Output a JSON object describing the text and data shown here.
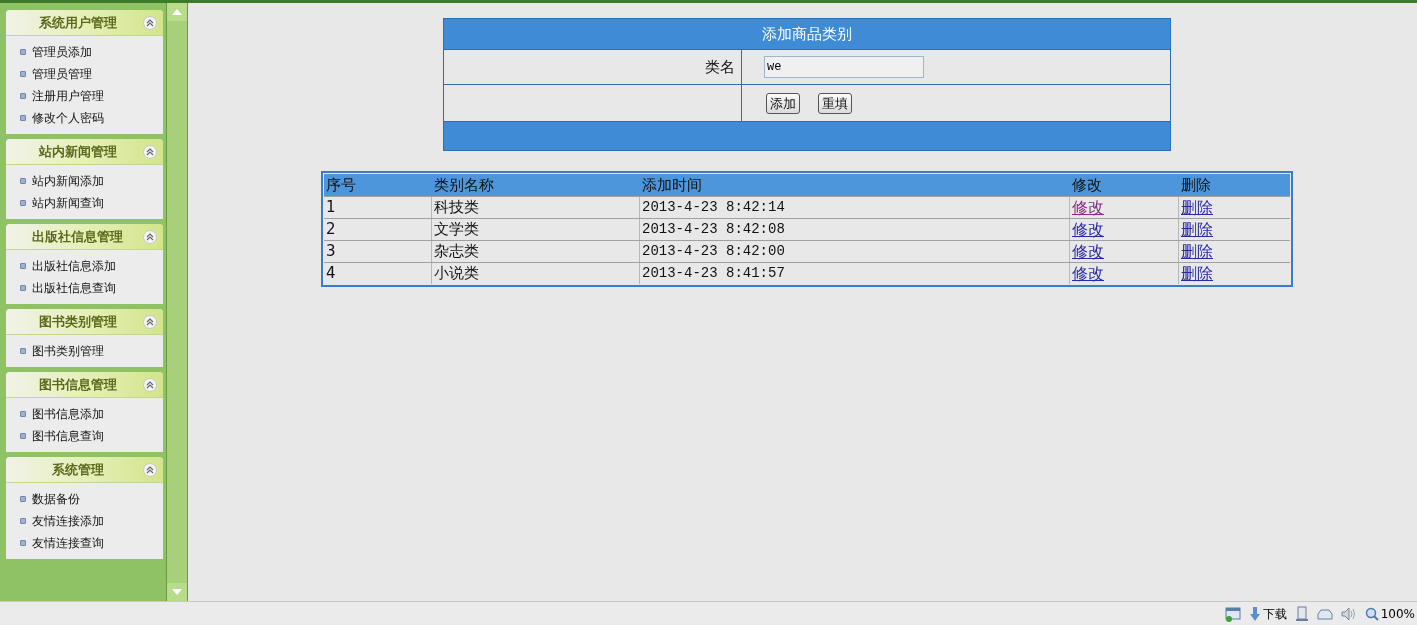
{
  "sidebar": {
    "groups": [
      {
        "title": "系统用户管理",
        "items": [
          "管理员添加",
          "管理员管理",
          "注册用户管理",
          "修改个人密码"
        ]
      },
      {
        "title": "站内新闻管理",
        "items": [
          "站内新闻添加",
          "站内新闻查询"
        ]
      },
      {
        "title": "出版社信息管理",
        "items": [
          "出版社信息添加",
          "出版社信息查询"
        ]
      },
      {
        "title": "图书类别管理",
        "items": [
          "图书类别管理"
        ]
      },
      {
        "title": "图书信息管理",
        "items": [
          "图书信息添加",
          "图书信息查询"
        ]
      },
      {
        "title": "系统管理",
        "items": [
          "数据备份",
          "友情连接添加",
          "友情连接查询"
        ]
      }
    ]
  },
  "form": {
    "title": "添加商品类别",
    "label": "类名",
    "value": "we",
    "buttons": [
      "添加",
      "重填"
    ]
  },
  "table": {
    "columns": [
      "序号",
      "类别名称",
      "添加时间",
      "修改",
      "删除"
    ],
    "rows": [
      {
        "cells": [
          "1",
          "科技类",
          "2013-4-23 8:42:14"
        ],
        "edit": "修改",
        "delete": "删除",
        "edit_visited": true
      },
      {
        "cells": [
          "2",
          "文学类",
          "2013-4-23 8:42:08"
        ],
        "edit": "修改",
        "delete": "删除",
        "edit_visited": false
      },
      {
        "cells": [
          "3",
          "杂志类",
          "2013-4-23 8:42:00"
        ],
        "edit": "修改",
        "delete": "删除",
        "edit_visited": false
      },
      {
        "cells": [
          "4",
          "小说类",
          "2013-4-23 8:41:57"
        ],
        "edit": "修改",
        "delete": "删除",
        "edit_visited": false
      }
    ]
  },
  "status_bar": {
    "download": "下载",
    "zoom": "100%"
  }
}
